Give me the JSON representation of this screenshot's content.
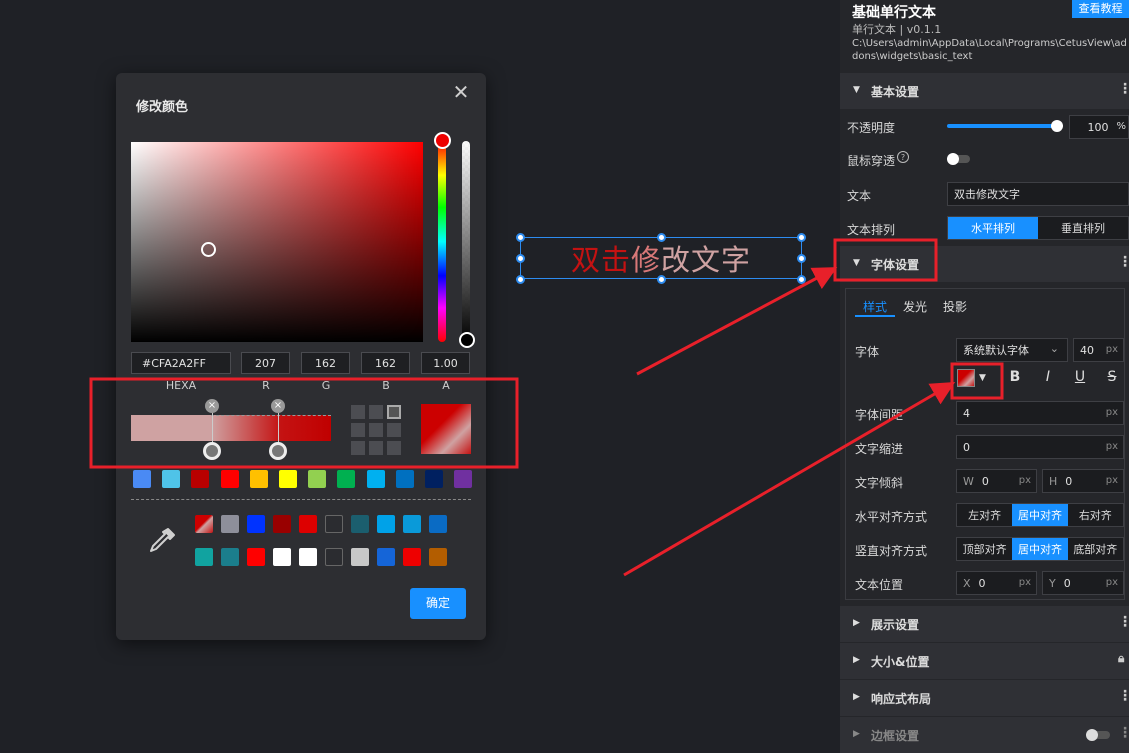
{
  "canvas": {
    "widget_text": "双击修改文字"
  },
  "picker": {
    "title": "修改颜色",
    "close_icon": "close-icon",
    "hexa_value": "#CFA2A2FF",
    "r_value": "207",
    "g_value": "162",
    "b_value": "162",
    "a_value": "1.00",
    "labels": {
      "hexa": "HEXA",
      "r": "R",
      "g": "G",
      "b": "B",
      "a": "A"
    },
    "gradient_stop_remove": "×",
    "palette_row1": [
      "#4a8af4",
      "#4fc3e8",
      "#b80000",
      "#ff0000",
      "#ffc000",
      "#ffff00",
      "#92d050",
      "#00b050",
      "#00b0f0",
      "#0070c0",
      "#002060",
      "#7030a0"
    ],
    "palette_row2": [
      "gradient",
      "#8e8f9a",
      "#0033ff",
      "#990000",
      "#dd0000",
      "#2b2c30",
      "#1b5e6e",
      "#00a2e8",
      "#0a9ad9",
      "#0a6bc4"
    ],
    "palette_row3": [
      "#11a3a0",
      "#1b7e8c",
      "#ff0000",
      "#ffffff",
      "#ffffff",
      "#2b2c30",
      "#c8c8c8",
      "#1565d8",
      "#ee0000",
      "#b35d00"
    ],
    "confirm_label": "确定",
    "eyedropper_icon": "eyedropper-icon"
  },
  "panel": {
    "title": "基础单行文本",
    "subtitle": "单行文本 | v0.1.1",
    "path": "C:\\Users\\admin\\AppData\\Local\\Programs\\CetusView\\addons\\widgets\\basic_text",
    "tutorial_label": "查看教程",
    "basic_section": "基本设置",
    "opacity_label": "不透明度",
    "opacity_value": "100",
    "opacity_unit": "%",
    "opacity_level": 1.0,
    "mouse_through_label": "鼠标穿透",
    "text_label": "文本",
    "text_value": "双击修改文字",
    "arrange_label": "文本排列",
    "arrange_options": [
      "水平排列",
      "垂直排列"
    ],
    "font_section": "字体设置",
    "tabs": [
      "样式",
      "发光",
      "投影"
    ],
    "font_label": "字体",
    "font_value": "系统默认字体",
    "font_size": "40",
    "px": "px",
    "format_icons": [
      "B",
      "I",
      "U",
      "S"
    ],
    "spacing_label": "字体间距",
    "spacing_value": "4",
    "indent_label": "文字缩进",
    "indent_value": "0",
    "skew_label": "文字倾斜",
    "w_label": "W",
    "h_label": "H",
    "skew_w": "0",
    "skew_h": "0",
    "halign_label": "水平对齐方式",
    "halign_options": [
      "左对齐",
      "居中对齐",
      "右对齐"
    ],
    "valign_label": "竖直对齐方式",
    "valign_options": [
      "顶部对齐",
      "居中对齐",
      "底部对齐"
    ],
    "pos_label": "文本位置",
    "x_label": "X",
    "y_label": "Y",
    "pos_x": "0",
    "pos_y": "0",
    "display_section": "展示设置",
    "size_section": "大小&位置",
    "responsive_section": "响应式布局",
    "border_section": "边框设置"
  },
  "colors": {
    "accent": "#1890ff",
    "annotation": "#e8202a",
    "text_red": "#c41212",
    "text_pink": "#cfa2a2"
  }
}
